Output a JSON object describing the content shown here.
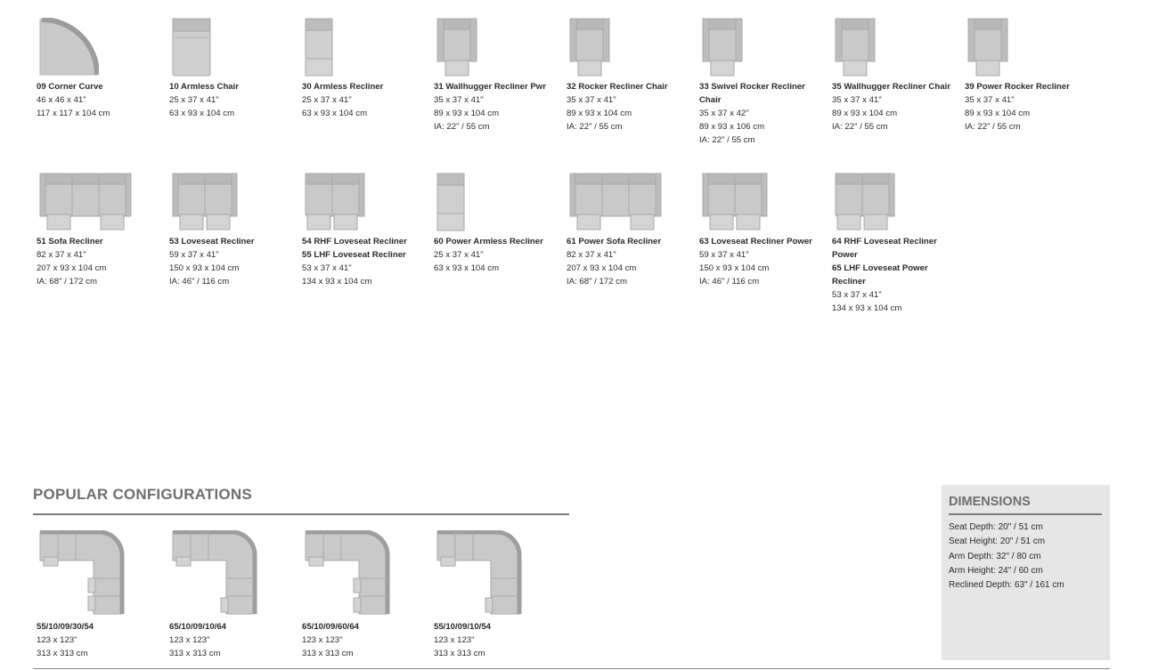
{
  "colors": {
    "upholstery": "#c9c9c9",
    "upholstery_dark": "#a9a9a9",
    "rule": "#7a7a7a",
    "panel": "#e6e6e6"
  },
  "pieces": [
    {
      "icon": "corner-curve-icon",
      "lines": [
        "09 Corner Curve",
        "46 x 46 x 41\"",
        "117 x 117 x 104 cm"
      ]
    },
    {
      "icon": "armless-chair-icon",
      "lines": [
        "10 Armless Chair",
        "25 x 37 x 41\"",
        "63 x 93 x 104 cm"
      ]
    },
    {
      "icon": "armless-recliner-icon",
      "lines": [
        "30 Armless Recliner",
        "25 x 37 x 41\"",
        "63 x 93 x 104 cm"
      ]
    },
    {
      "icon": "wallhugger-recliner-icon",
      "lines": [
        "31 Wallhugger Recliner Pwr",
        "35 x 37 x 41\"",
        "89 x 93 x 104 cm",
        "IA: 22\" / 55 cm"
      ]
    },
    {
      "icon": "rocker-recliner-icon",
      "lines": [
        "32 Rocker Recliner Chair",
        "35 x 37 x 41\"",
        "89 x 93 x 104 cm",
        "IA: 22\" / 55 cm"
      ]
    },
    {
      "icon": "swivel-rocker-recliner-icon",
      "lines": [
        "33 Swivel Rocker Recliner",
        "Chair",
        "35 x 37 x 42\"",
        "89 x 93 x 106 cm",
        "IA: 22\" / 55 cm"
      ]
    },
    {
      "icon": "wallhugger-recliner-chair-icon",
      "lines": [
        "35 Wallhugger Recliner Chair",
        "35 x 37 x 41\"",
        "89 x 93 x 104 cm",
        "IA: 22\" / 55 cm"
      ]
    },
    {
      "icon": "power-rocker-recliner-icon",
      "lines": [
        "39 Power Rocker Recliner",
        "35 x 37 x 41\"",
        "89 x 93 x 104 cm",
        "IA: 22\" / 55 cm"
      ]
    },
    {
      "icon": "sofa-recliner-icon",
      "lines": [
        "51 Sofa Recliner",
        "82 x 37 x 41\"",
        "207 x 93 x 104 cm",
        "IA: 68\" / 172 cm"
      ]
    },
    {
      "icon": "loveseat-recliner-icon",
      "lines": [
        "53 Loveseat Recliner",
        "59 x 37 x 41\"",
        "150 x 93 x 104 cm",
        "IA: 46\" / 116 cm"
      ]
    },
    {
      "icon": "rhf-loveseat-recliner-icon",
      "lines": [
        "54 RHF Loveseat Recliner",
        "55 LHF Loveseat Recliner",
        "53 x 37 x 41\"",
        "134 x 93 x 104 cm"
      ]
    },
    {
      "icon": "power-armless-recliner-icon",
      "lines": [
        "60 Power Armless Recliner",
        "25 x 37 x 41\"",
        "63 x 93 x 104 cm"
      ]
    },
    {
      "icon": "power-sofa-recliner-icon",
      "lines": [
        "61 Power Sofa Recliner",
        "82 x 37 x 41\"",
        "207 x 93 x 104 cm",
        "IA: 68\" / 172 cm"
      ]
    },
    {
      "icon": "loveseat-recliner-power-icon",
      "lines": [
        "63 Loveseat Recliner Power",
        "59 x 37 x 41\"",
        "150 x 93 x 104 cm",
        "IA: 46\" / 116 cm"
      ]
    },
    {
      "icon": "rhf-loveseat-power-icon",
      "lines": [
        "64 RHF Loveseat Recliner",
        "Power",
        "65 LHF Loveseat Power",
        "Recliner",
        "53 x 37 x 41\"",
        "134 x 93 x 104 cm"
      ]
    }
  ],
  "popular": {
    "title": "POPULAR CONFIGURATIONS",
    "items": [
      {
        "icon": "sectional-config-icon",
        "lines": [
          "55/10/09/30/54",
          "123 x 123\"",
          "313 x 313 cm"
        ]
      },
      {
        "icon": "sectional-config-icon",
        "lines": [
          "65/10/09/10/64",
          "123 x 123\"",
          "313 x 313 cm"
        ]
      },
      {
        "icon": "sectional-config-icon",
        "lines": [
          "65/10/09/60/64",
          "123 x 123\"",
          "313 x 313 cm"
        ]
      },
      {
        "icon": "sectional-config-icon",
        "lines": [
          "55/10/09/10/54",
          "123 x 123\"",
          "313 x 313 cm"
        ]
      }
    ]
  },
  "dimensions": {
    "title": "DIMENSIONS",
    "lines": [
      "Seat Depth: 20\" / 51 cm",
      "Seat Height: 20\" / 51 cm",
      "Arm Depth: 32\" / 80 cm",
      "Arm Height: 24\" / 60 cm",
      "Reclined Depth: 63\" / 161 cm"
    ]
  }
}
